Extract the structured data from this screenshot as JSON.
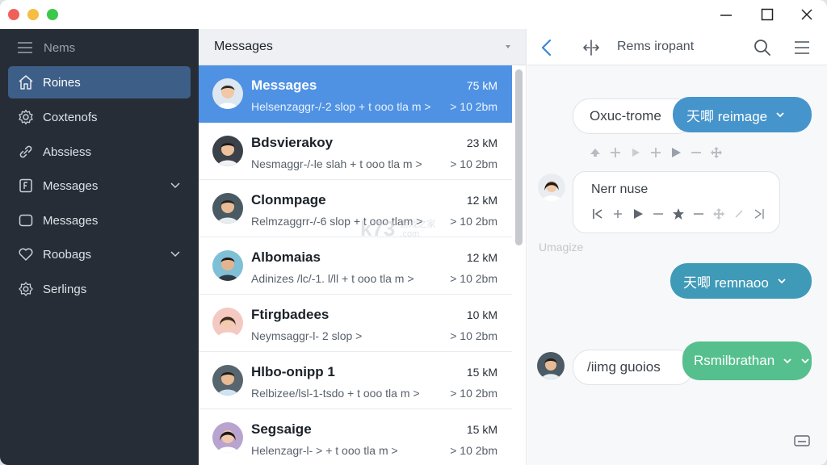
{
  "sidebar": {
    "header": "Nems",
    "items": [
      {
        "label": "Roines",
        "icon": "home-icon",
        "active": true
      },
      {
        "label": "Coxtenofs",
        "icon": "gear-icon"
      },
      {
        "label": "Abssiess",
        "icon": "link-icon"
      },
      {
        "label": "Messages",
        "icon": "document-icon",
        "expandable": true
      },
      {
        "label": "Messages",
        "icon": "square-icon"
      },
      {
        "label": "Roobags",
        "icon": "heart-icon",
        "expandable": true
      },
      {
        "label": "Serlings",
        "icon": "settings-icon"
      }
    ]
  },
  "list": {
    "title": "Messages",
    "rows": [
      {
        "name": "Messages",
        "size": "75 kM",
        "preview": "Helsenzaggr-/-2 slop + t ooo tla m >",
        "time": "> 10 2bm",
        "selected": true
      },
      {
        "name": "Bdsvierakoy",
        "size": "23 kM",
        "preview": "Nesmaggr-/-le slah + t ooo tla m >",
        "time": "> 10 2bm"
      },
      {
        "name": "Clonmpage",
        "size": "12 kM",
        "preview": "Relmzaggrr-/-6 slop + t ooo tlam >",
        "time": "> 10 2bm"
      },
      {
        "name": "Albomaias",
        "size": "12 kM",
        "preview": "Adinizes /lc/-1. l/ll + t ooo tla m >",
        "time": "> 10 2bm"
      },
      {
        "name": "Ftirgbadees",
        "size": "10 kM",
        "preview": "Neymsaggr-l- 2 slop >",
        "time": "> 10 2bm"
      },
      {
        "name": "Hlbo-onipp 1",
        "size": "15 kM",
        "preview": "Relbizee/lsl-1-tsdo + t ooo tla m >",
        "time": "> 10 2bm"
      },
      {
        "name": "Segsaige",
        "size": "15 kM",
        "preview": "Helenzagr-l- > + t ooo tla m >",
        "time": "> 10 2bm"
      }
    ]
  },
  "chat": {
    "title": "Rems iropant",
    "messages": {
      "m1_in": "Oxuc-trome",
      "m1_out": "天唧 reimage",
      "m2_in": "Nerr nuse",
      "faint": "Umagize",
      "m3_out": "天唧 remnaoo",
      "m4_in": "/iimg guoios",
      "m4_out": "Rsmilbrathan"
    }
  },
  "watermark": {
    "brand": "k73",
    "cn": "游戏之家",
    "domain": ".com"
  },
  "colors": {
    "sidebar": "#262d36",
    "selected_row": "#4f92e3",
    "active_nav": "#3d5f87",
    "bubble_blue": "#4694cc",
    "bubble_teal": "#3f9ab8",
    "bubble_green": "#55c08d"
  }
}
